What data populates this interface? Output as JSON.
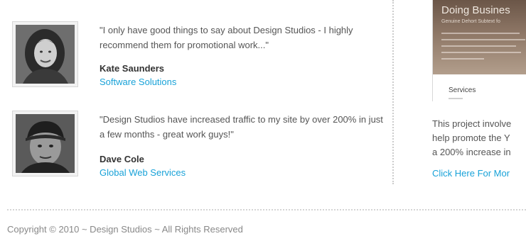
{
  "testimonials": [
    {
      "quote": "\"I only have good things to say about Design Studios - I highly recommend them for promotional work...\"",
      "author": "Kate Saunders",
      "company": "Software Solutions"
    },
    {
      "quote": "\"Design Studios have increased traffic to my site by over 200% in just a few months - great work guys!\"",
      "author": "Dave Cole",
      "company": "Global Web Services"
    }
  ],
  "project": {
    "screenshot": {
      "heading": "Doing Busines",
      "subheading": "Genuine Dehort Subtext fo",
      "services_label": "Services"
    },
    "description_lines": [
      "This project involve",
      "help promote the Y",
      "a 200% increase in"
    ],
    "link_label": "Click Here For Mor"
  },
  "footer": {
    "copyright": "Copyright © 2010 ~ Design Studios ~ All Rights Reserved"
  },
  "colors": {
    "link": "#18a2d8",
    "text": "#555555",
    "author": "#333333",
    "footer_text": "#888888",
    "divider": "#cccccc"
  }
}
